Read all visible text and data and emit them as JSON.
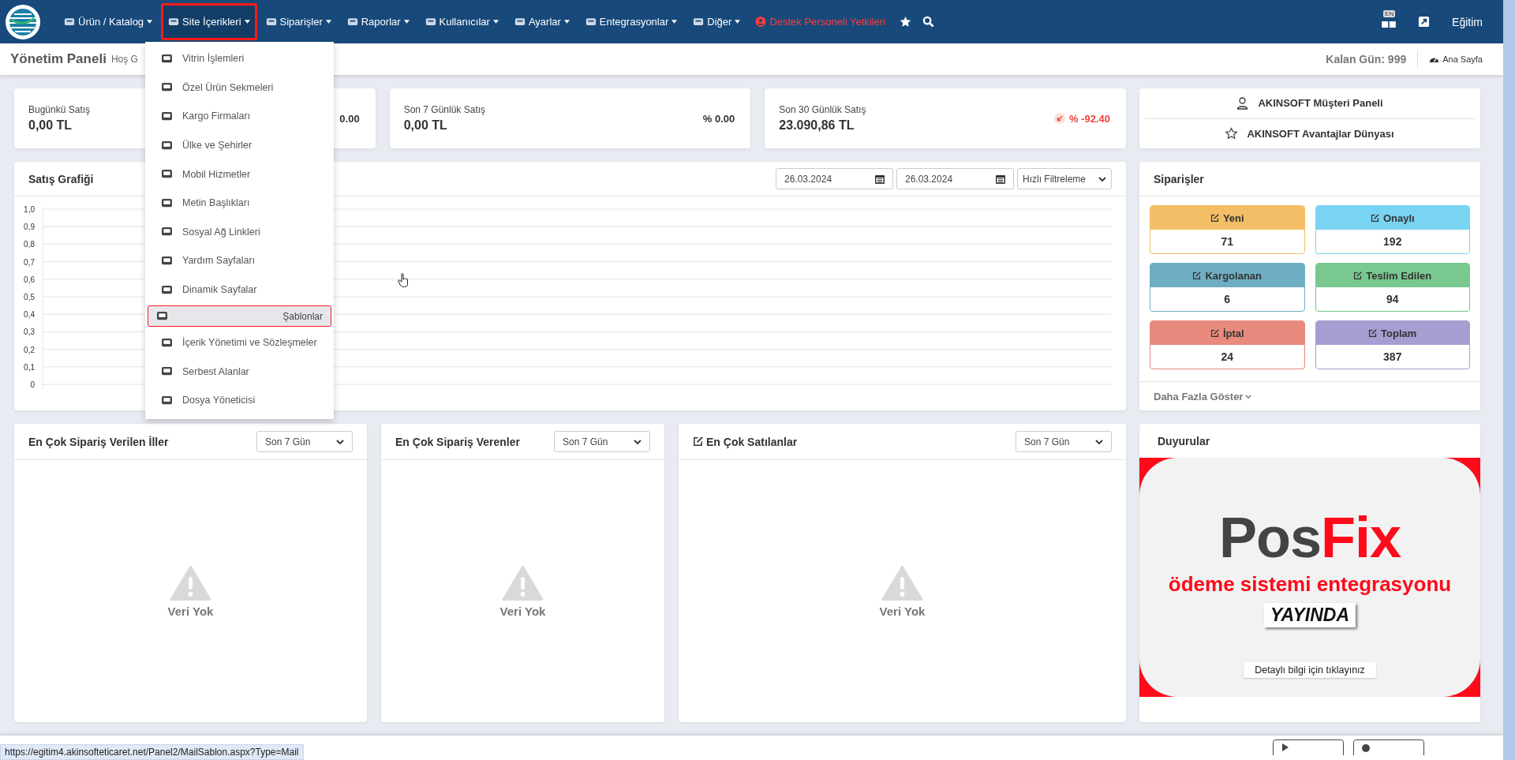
{
  "nav": {
    "items": [
      {
        "label": "Ürün / Katalog",
        "open": false
      },
      {
        "label": "Site İçerikleri",
        "open": true
      },
      {
        "label": "Siparişler",
        "open": false
      },
      {
        "label": "Raporlar",
        "open": false
      },
      {
        "label": "Kullanıcılar",
        "open": false
      },
      {
        "label": "Ayarlar",
        "open": false
      },
      {
        "label": "Entegrasyonlar",
        "open": false
      },
      {
        "label": "Diğer",
        "open": false
      }
    ],
    "support": "Destek Personeli Yetkileri",
    "language_badge": "EN",
    "user": "Eğitim"
  },
  "menu": {
    "items": [
      {
        "label": "Vitrin İşlemleri",
        "selected": false
      },
      {
        "label": "Özel Ürün Sekmeleri",
        "selected": false
      },
      {
        "label": "Kargo Firmaları",
        "selected": false
      },
      {
        "label": "Ülke ve Şehirler",
        "selected": false
      },
      {
        "label": "Mobil Hizmetler",
        "selected": false
      },
      {
        "label": "Metin Başlıkları",
        "selected": false
      },
      {
        "label": "Sosyal Ağ Linkleri",
        "selected": false
      },
      {
        "label": "Yardım Sayfaları",
        "selected": false
      },
      {
        "label": "Dinamik Sayfalar",
        "selected": false
      },
      {
        "label": "Şablonlar",
        "selected": true
      },
      {
        "label": "İçerik Yönetimi ve Sözleşmeler",
        "selected": false
      },
      {
        "label": "Serbest Alanlar",
        "selected": false
      },
      {
        "label": "Dosya Yöneticisi",
        "selected": false
      }
    ]
  },
  "header": {
    "title": "Yönetim Paneli",
    "subtitle": "Hoş G",
    "days_left": "Kalan Gün: 999",
    "home": "Ana Sayfa"
  },
  "stats": [
    {
      "label": "Bugünkü Satış",
      "value": "0,00 TL",
      "change": "0.00",
      "declining": false
    },
    {
      "label": "Son 7 Günlük Satış",
      "value": "0,00 TL",
      "change": "% 0.00",
      "declining": false
    },
    {
      "label": "Son 30 Günlük Satış",
      "value": "23.090,86 TL",
      "change": "% -92.40",
      "declining": true
    }
  ],
  "links": [
    "AKINSOFT Müşteri Paneli",
    "AKINSOFT Avantajlar Dünyası"
  ],
  "sales_chart": {
    "title": "Satış Grafiği",
    "date_from": "26.03.2024",
    "date_to": "26.03.2024",
    "filter": "Hızlı Filtreleme",
    "y_axis_labels": [
      "1,0",
      "0,9",
      "0,8",
      "0,7",
      "0,6",
      "0,5",
      "0,4",
      "0,3",
      "0,2",
      "0,1",
      "0"
    ]
  },
  "orders": {
    "title": "Siparişler",
    "tiles": [
      {
        "label": "Yeni",
        "count": "71",
        "color": "#f4be66"
      },
      {
        "label": "Onaylı",
        "count": "192",
        "color": "#79d3f2"
      },
      {
        "label": "Kargolanan",
        "count": "6",
        "color": "#6eaec2"
      },
      {
        "label": "Teslim Edilen",
        "count": "94",
        "color": "#78c88f"
      },
      {
        "label": "İptal",
        "count": "24",
        "color": "#e88a7e"
      },
      {
        "label": "Toplam",
        "count": "387",
        "color": "#a49ed1"
      }
    ],
    "more": "Daha Fazla Göster"
  },
  "panels": [
    {
      "title": "En Çok Sipariş Verilen İller",
      "period": "Son 7 Gün",
      "empty": "Veri Yok",
      "edit_icon": false
    },
    {
      "title": "En Çok Sipariş Verenler",
      "period": "Son 7 Gün",
      "empty": "Veri Yok",
      "edit_icon": false
    },
    {
      "title": "En Çok Satılanlar",
      "period": "Son 7 Gün",
      "empty": "Veri Yok",
      "edit_icon": true
    }
  ],
  "announcements": {
    "title": "Duyurular",
    "brand_left": "Pos",
    "brand_right": "Fix",
    "headline": "ödeme sistemi entegrasyonu",
    "tag": "YAYINDA",
    "cta": "Detaylı bilgi için tıklayınız"
  },
  "status_url": "https://egitim4.akinsofteticaret.net/Panel2/MailSablon.aspx?Type=Mail"
}
